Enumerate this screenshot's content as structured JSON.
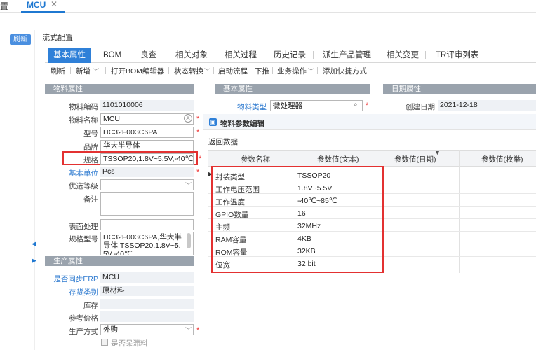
{
  "topbar": {
    "cut_text": "置",
    "tab_title": "MCU",
    "close_icon": "close-icon"
  },
  "sidebar": {
    "refresh_label": "刷新"
  },
  "page": {
    "title": "流式配置"
  },
  "tabs": [
    {
      "label": "基本属性"
    },
    {
      "label": "BOM"
    },
    {
      "label": "良查"
    },
    {
      "label": "相关对象"
    },
    {
      "label": "相关过程"
    },
    {
      "label": "历史记录"
    },
    {
      "label": "派生产品管理"
    },
    {
      "label": "相关变更"
    },
    {
      "label": "TR评审列表"
    }
  ],
  "toolbar": {
    "refresh": "刷新",
    "new": "新增",
    "open_bom": "打开BOM编辑器",
    "state": "状态转换",
    "start_flow": "启动流程",
    "push": "下推",
    "business": "业务操作",
    "shortcut": "添加快捷方式"
  },
  "sections": {
    "material": "物料属性",
    "basic": "基本属性",
    "date": "日期属性",
    "production": "生产属性"
  },
  "material": {
    "code_label": "物料编码",
    "code": "1101010006",
    "name_label": "物料名称",
    "name": "MCU",
    "model_label": "型号",
    "model": "HC32F003C6PA",
    "brand_label": "品牌",
    "brand": "华大半导体",
    "spec_label": "规格",
    "spec": "TSSOP20,1.8V~5.5V,-40℃…",
    "unit_label": "基本单位",
    "unit": "Pcs",
    "level_label": "优选等级",
    "level": "",
    "remark_label": "备注",
    "remark": "",
    "surface_label": "表面处理",
    "surface": "",
    "spec_model_label": "规格型号",
    "spec_model": "HC32F003C6PA,华大半导体,TSSOP20,1.8V~5.5V,-40℃"
  },
  "basic": {
    "type_label": "物料类型",
    "type": "微处理器"
  },
  "date": {
    "created_label": "创建日期",
    "created": "2021-12-18"
  },
  "production": {
    "sync_label": "是否同步ERP",
    "sync": "MCU",
    "stock_cat_label": "存货类别",
    "stock_cat": "原材料",
    "stock_label": "库存",
    "stock": "",
    "ref_price_label": "参考价格",
    "ref_price": "",
    "method_label": "生产方式",
    "method": "外购",
    "bulk_label": "是否呆滞料"
  },
  "dialog": {
    "title": "物料参数编辑",
    "back": "返回数据",
    "headers": [
      "参数名称",
      "参数值(文本)",
      "参数值(日期)",
      "参数值(枚举)"
    ],
    "rows": [
      {
        "name": "封装类型",
        "value": "TSSOP20"
      },
      {
        "name": "工作电压范围",
        "value": "1.8V~5.5V"
      },
      {
        "name": "工作温度",
        "value": "-40℃~85℃"
      },
      {
        "name": "GPIO数量",
        "value": "16"
      },
      {
        "name": "主频",
        "value": "32MHz"
      },
      {
        "name": "RAM容量",
        "value": "4KB"
      },
      {
        "name": "ROM容量",
        "value": "32KB"
      },
      {
        "name": "位宽",
        "value": "32 bit"
      }
    ]
  }
}
